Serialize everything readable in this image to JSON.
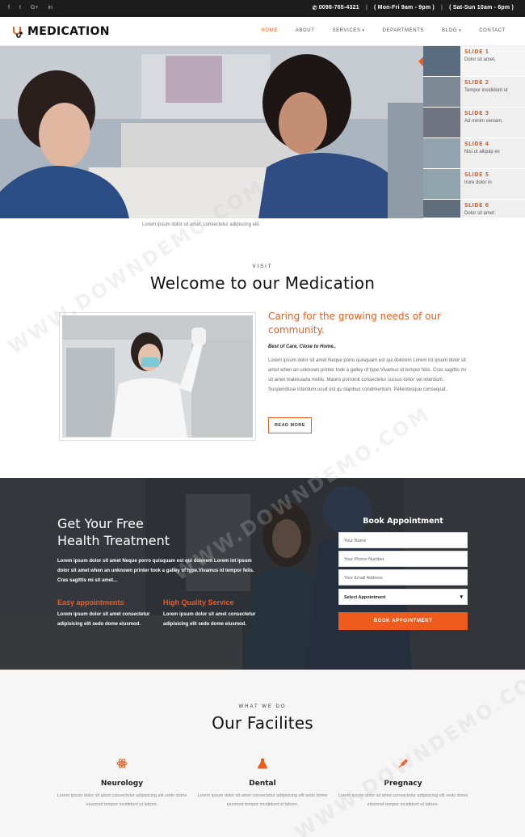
{
  "topbar": {
    "socials": [
      "f",
      "t",
      "G+",
      "in"
    ],
    "phone": "0098-765-4321",
    "hours_week": "( Mon-Fri 9am - 9pm )",
    "hours_weekend": "( Sat-Sun 10am - 6pm )"
  },
  "header": {
    "logo": "MEDICATION",
    "nav": [
      {
        "label": "HOME",
        "active": true
      },
      {
        "label": "ABOUT"
      },
      {
        "label": "SERVICES",
        "caret": "▾"
      },
      {
        "label": "DEPARTMENTS"
      },
      {
        "label": "BLOG",
        "caret": "▾"
      },
      {
        "label": "CONTACT"
      }
    ]
  },
  "hero": {
    "slides": [
      {
        "label": "SLIDE 1",
        "desc": "Dolor sit amet,"
      },
      {
        "label": "SLIDE 2",
        "desc": "Tempor incididunt ut"
      },
      {
        "label": "SLIDE 3",
        "desc": "Ad minim veniam,"
      },
      {
        "label": "SLIDE 4",
        "desc": "Nisi ut aliquip ex"
      },
      {
        "label": "SLIDE 5",
        "desc": "Irure dolor in"
      },
      {
        "label": "SLIDE 6",
        "desc": "Dolor sit amet"
      }
    ],
    "caption": "Lorem ipsum dolor sit amet, consectetur adipiscing elit."
  },
  "welcome": {
    "kicker": "VISIT",
    "title": "Welcome to our Medication",
    "heading": "Caring for the growing needs of our community.",
    "subheading": "Best of Care, Close to Home..",
    "body": "Lorem ipsum dolor sit amet Neque porro quisquam est qui dolorem Lorem int ipsum dolor sit amet when an unknown printer took a galley of type.Vivamus id tempor felis. Cras sagittis mi sit amet malesuada mollis. Mauris porroinit consectetur cursus tortor vel interdum. Suspendisse interdum ucuit est qu dapibus condimentum. Pellentesque consequat.",
    "read_more": "READ MORE"
  },
  "treatment": {
    "title_line1": "Get Your Free",
    "title_line2": "Health Treatment",
    "body": "Lorem ipsum dolor sit amet Neque porro quisquam est qui dolorem Lorem int ipsum dolor sit amet when an unknown printer took a galley of type.Vivamus id tempor felis. Cras sagittis mi sit amet...",
    "features": [
      {
        "title": "Easy appointments",
        "desc": "Lorem ipsum dolor sit amet consectetur adipisicing elit sedo dome eiusmod."
      },
      {
        "title": "High Quality Service",
        "desc": "Lorem ipsum dolor sit amet consectetur adipisicing elit sedo dome eiusmod."
      }
    ],
    "form": {
      "title": "Book Appointment",
      "name_placeholder": "Your Name",
      "phone_placeholder": "Your Phone Number",
      "email_placeholder": "Your Email Address",
      "select_value": "Select Appointment",
      "submit": "BOOK APPOINTMENT"
    }
  },
  "facilities": {
    "kicker": "WHAT WE DO",
    "title": "Our Facilites",
    "items": [
      {
        "name": "Neurology",
        "icon": "atom-icon",
        "desc": "Lorem ipsum dolor sit amet consectetur adipisicing elit sedo dome eiusmod tempor incididunt ut labore."
      },
      {
        "name": "Dental",
        "icon": "flask-icon",
        "desc": "Lorem ipsum dolor sit amet consectetur adipisicing elit sedo dome eiusmod tempor incididunt ut labore."
      },
      {
        "name": "Pregnacy",
        "icon": "syringe-icon",
        "desc": "Lorem ipsum dolor sit amet consectetur adipisicing elit sedo dome eiusmod tempor incididunt ut labore."
      }
    ]
  },
  "watermark": "WWW.DOWNDEMO.COM",
  "colors": {
    "accent": "#ef5a1d",
    "topbar": "#1c1c1c"
  }
}
